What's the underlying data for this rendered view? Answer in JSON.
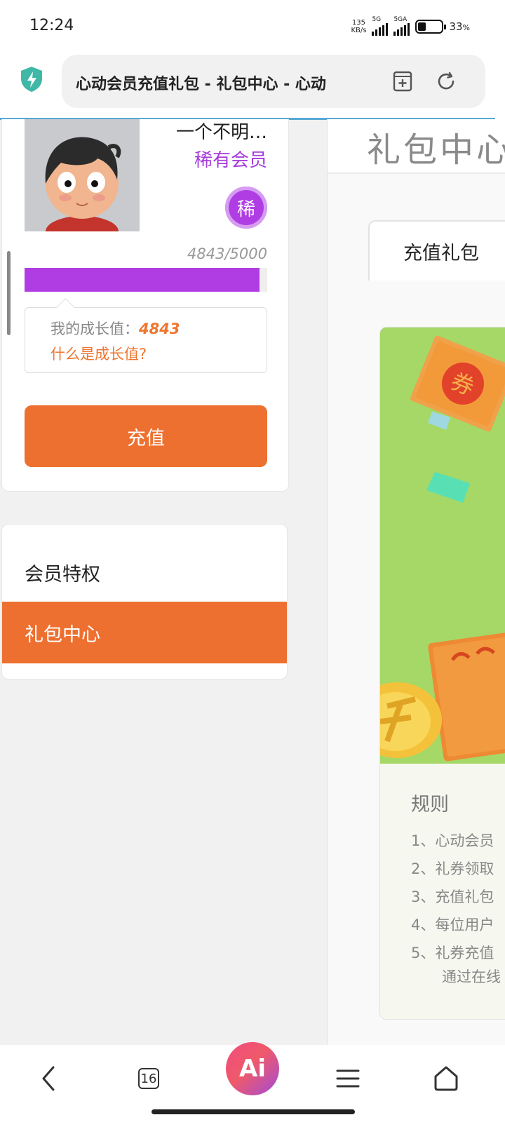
{
  "status_bar": {
    "time": "12:24",
    "net_speed_value": "135",
    "net_speed_unit": "KB/s",
    "sim1_label": "5G",
    "sim2_label": "5GA",
    "battery_percent": "33",
    "battery_unit": "%",
    "battery_level": 0.33
  },
  "browser": {
    "tab_title": "心动会员充值礼包 - 礼包中心 - 心动",
    "tab_count": "16",
    "ai_label": "Ai",
    "icons": [
      "shield-bolt-icon",
      "add-bookmark-icon",
      "reload-icon",
      "back-icon",
      "tabs-icon",
      "ai-assistant-icon",
      "menu-icon",
      "home-icon"
    ]
  },
  "profile": {
    "username": "一个不明…",
    "member_level": "稀有会员",
    "level_badge": "稀",
    "progress_text": "4843/5000",
    "progress_fraction": 0.9686,
    "growth_label": "我的成长值：",
    "growth_value": "4843",
    "growth_help_link": "什么是成长值?",
    "recharge_label": "充值"
  },
  "sidebar_menu": {
    "items": [
      {
        "label": "会员特权",
        "active": false
      },
      {
        "label": "礼包中心",
        "active": true
      }
    ]
  },
  "main": {
    "page_title": "礼包中心",
    "tabs": [
      {
        "label": "充值礼包",
        "active": true
      }
    ],
    "rules_title": "规则",
    "rules": [
      "1、心动会员",
      "2、礼券领取",
      "3、充值礼包",
      "4、每位用户",
      "5、礼券充值",
      "通过在线"
    ]
  },
  "colors": {
    "accent_orange": "#ed7030",
    "member_purple": "#b03de3",
    "banner_green": "#a5d866",
    "load_line_blue": "#59a8d3"
  }
}
